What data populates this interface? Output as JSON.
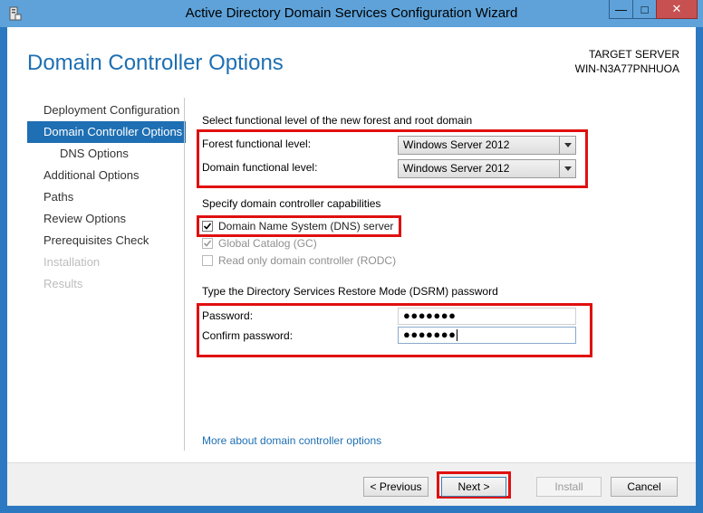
{
  "window": {
    "title": "Active Directory Domain Services Configuration Wizard",
    "minimize": "—",
    "maximize": "□",
    "close": "✕"
  },
  "header": {
    "page_title": "Domain Controller Options",
    "target_label": "TARGET SERVER",
    "target_name": "WIN-N3A77PNHUOA"
  },
  "nav": {
    "items": [
      {
        "label": "Deployment Configuration",
        "state": "normal"
      },
      {
        "label": "Domain Controller Options",
        "state": "active"
      },
      {
        "label": "DNS Options",
        "state": "sub"
      },
      {
        "label": "Additional Options",
        "state": "normal"
      },
      {
        "label": "Paths",
        "state": "normal"
      },
      {
        "label": "Review Options",
        "state": "normal"
      },
      {
        "label": "Prerequisites Check",
        "state": "normal"
      },
      {
        "label": "Installation",
        "state": "disabled"
      },
      {
        "label": "Results",
        "state": "disabled"
      }
    ]
  },
  "functional": {
    "section_label": "Select functional level of the new forest and root domain",
    "forest_label": "Forest functional level:",
    "forest_value": "Windows Server 2012",
    "domain_label": "Domain functional level:",
    "domain_value": "Windows Server 2012"
  },
  "capabilities": {
    "section_label": "Specify domain controller capabilities",
    "dns_label": "Domain Name System (DNS) server",
    "gc_label": "Global Catalog (GC)",
    "rodc_label": "Read only domain controller (RODC)"
  },
  "dsrm": {
    "section_label": "Type the Directory Services Restore Mode (DSRM) password",
    "password_label": "Password:",
    "password_value": "●●●●●●●",
    "confirm_label": "Confirm password:",
    "confirm_value": "●●●●●●●"
  },
  "more_link": "More about domain controller options",
  "footer": {
    "previous": "< Previous",
    "next": "Next >",
    "install": "Install",
    "cancel": "Cancel"
  },
  "colors": {
    "accent": "#1e6fb3",
    "highlight_box": "#e01010",
    "titlebar": "#5ea2d9"
  },
  "icons": {
    "app": "server-wizard-icon",
    "dropdown": "chevron-down-icon",
    "check": "checkmark-icon"
  }
}
